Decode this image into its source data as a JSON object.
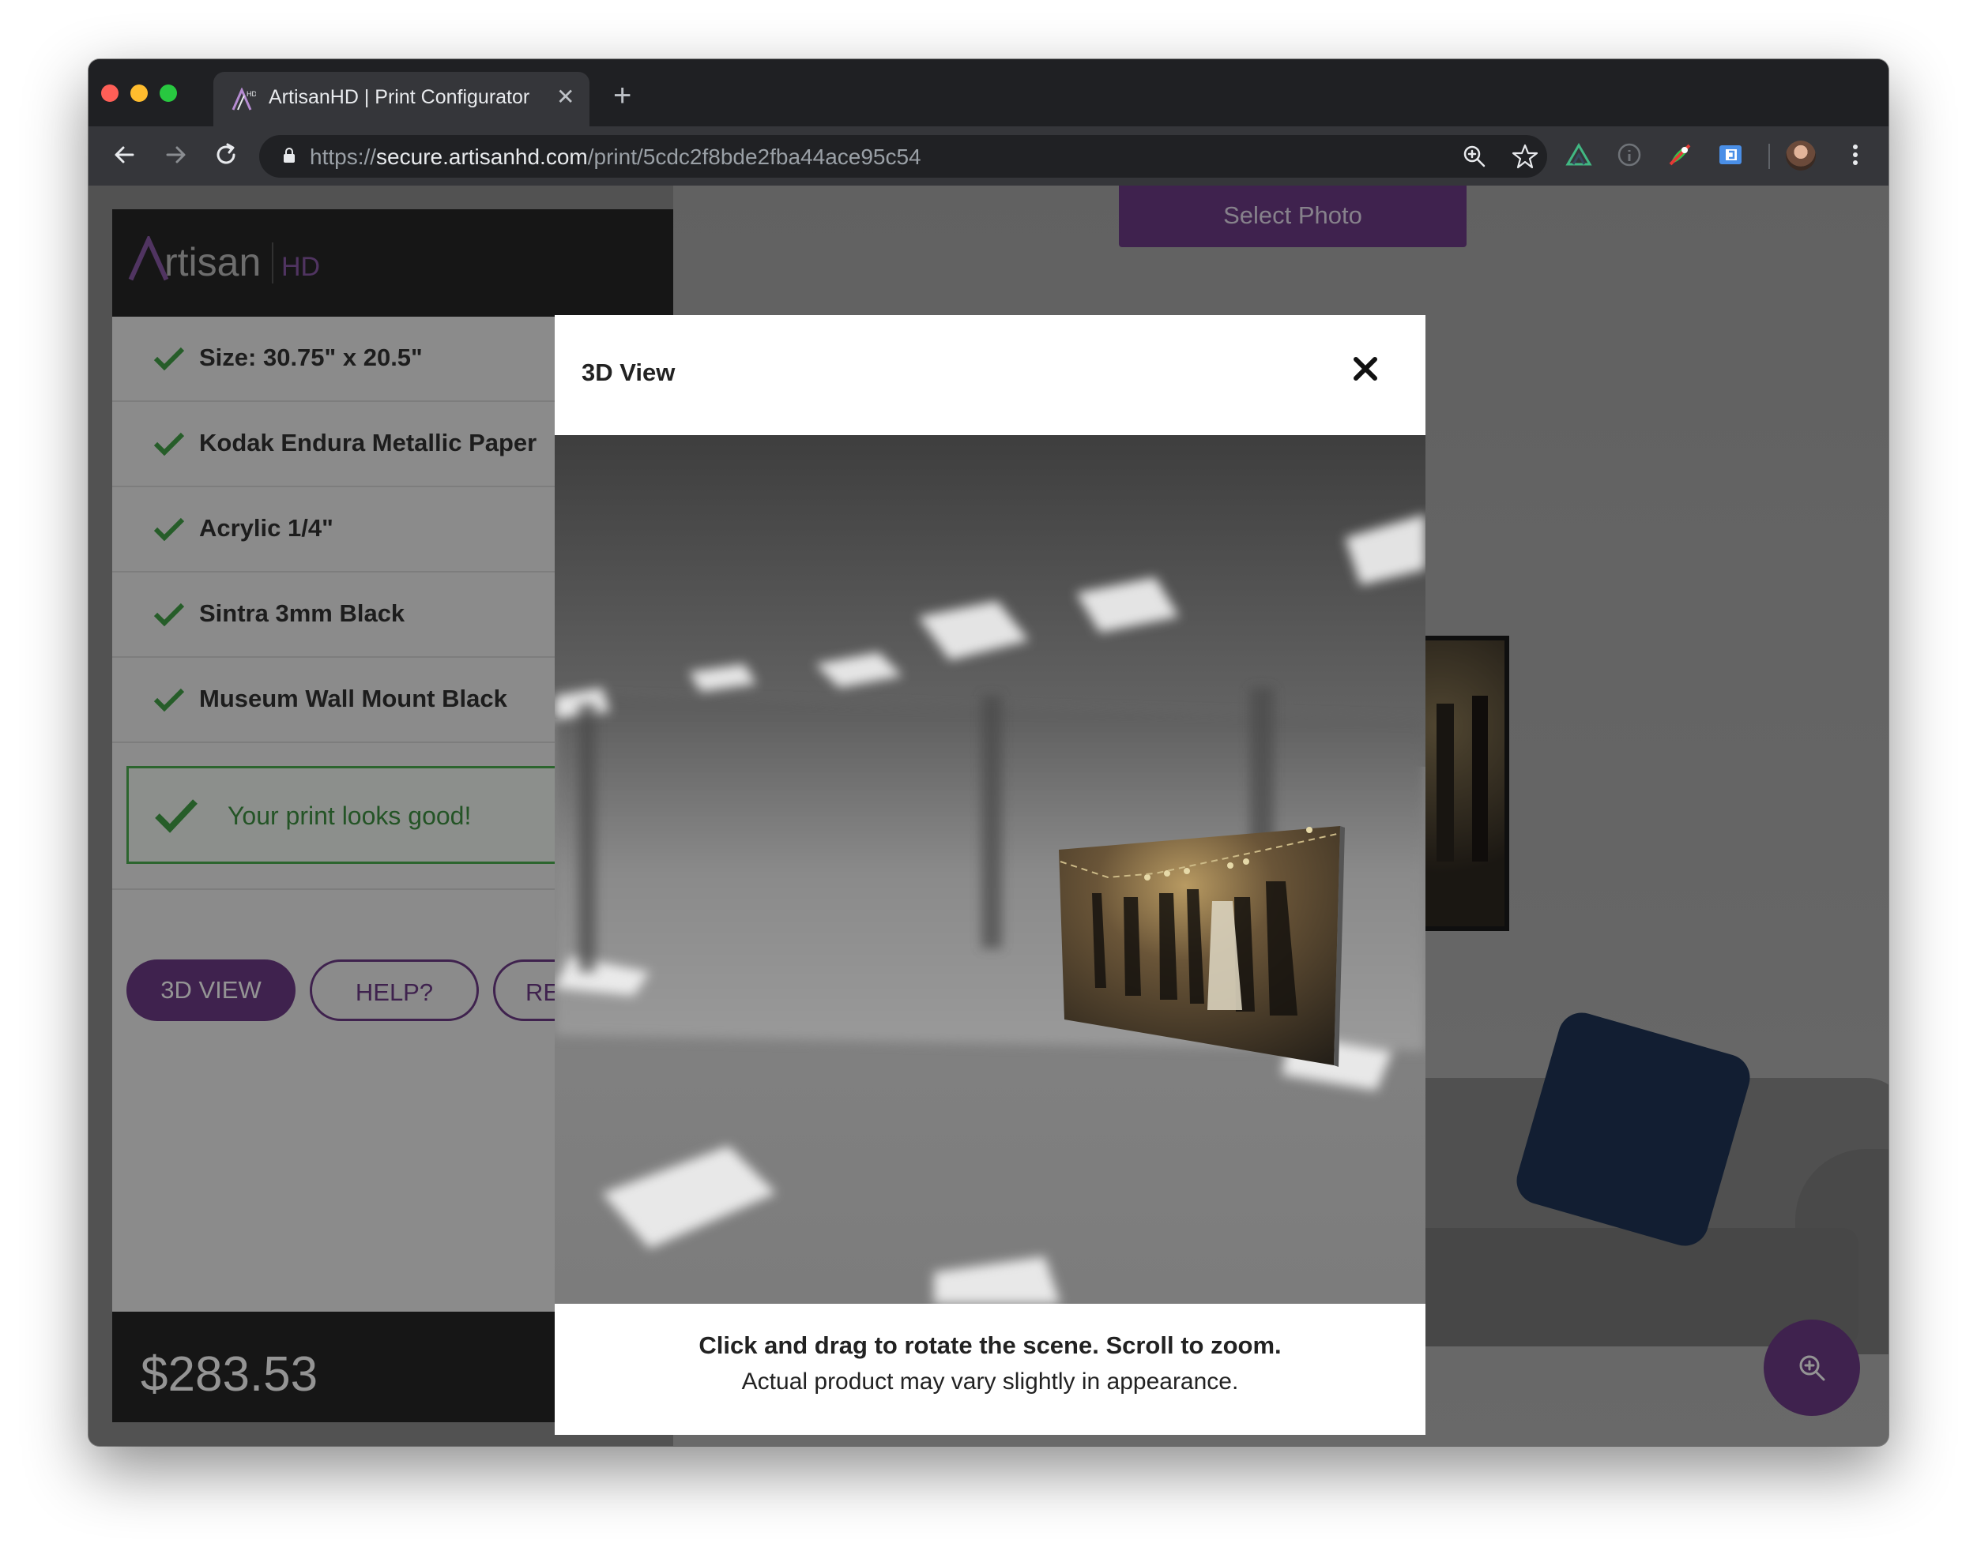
{
  "browser": {
    "tab_title": "ArtisanHD | Print Configurator",
    "url_scheme": "https://",
    "url_host": "secure.artisanhd.com",
    "url_path": "/print/5cdc2f8bde2fba44ace95c54"
  },
  "brand": {
    "logo_text": "rtisan",
    "logo_suffix": "HD",
    "accent_color": "#6d3b87",
    "success_color": "#43a047"
  },
  "options": [
    {
      "label": "Size: 30.75\" x 20.5\""
    },
    {
      "label": "Kodak Endura Metallic Paper"
    },
    {
      "label": "Acrylic 1/4\""
    },
    {
      "label": "Sintra 3mm Black"
    },
    {
      "label": "Museum Wall Mount Black"
    }
  ],
  "status": {
    "message": "Your print looks good!"
  },
  "actions": {
    "view3d": "3D VIEW",
    "help": "HELP?",
    "third": "RE"
  },
  "price": "$283.53",
  "select_photo": "Select Photo",
  "modal": {
    "title": "3D View",
    "instructions": "Click and drag to rotate the scene. Scroll to zoom.",
    "disclaimer": "Actual product may vary slightly in appearance."
  },
  "icons": {
    "close": "close-icon",
    "check": "check-icon",
    "zoom": "zoom-in-icon"
  }
}
